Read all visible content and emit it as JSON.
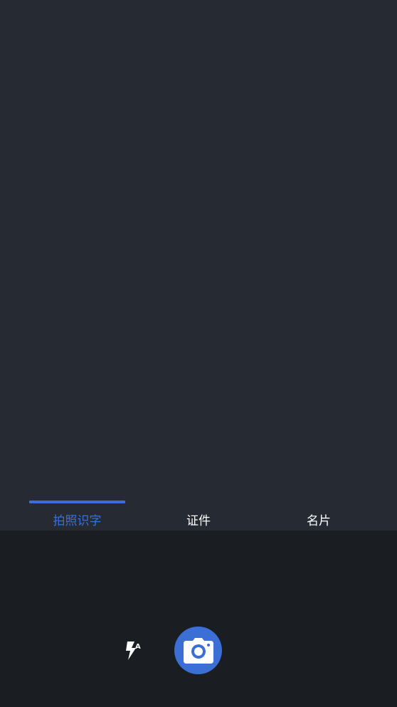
{
  "tabs": [
    {
      "label": "拍照识字",
      "active": true
    },
    {
      "label": "证件",
      "active": false
    },
    {
      "label": "名片",
      "active": false
    }
  ],
  "controls": {
    "flash_icon": "flash-auto-icon",
    "shutter_icon": "camera-icon"
  },
  "colors": {
    "accent": "#3b6fd6",
    "viewfinder_bg": "#262b33",
    "bottom_bg": "#1a1d21",
    "text_inactive": "#ffffff"
  }
}
